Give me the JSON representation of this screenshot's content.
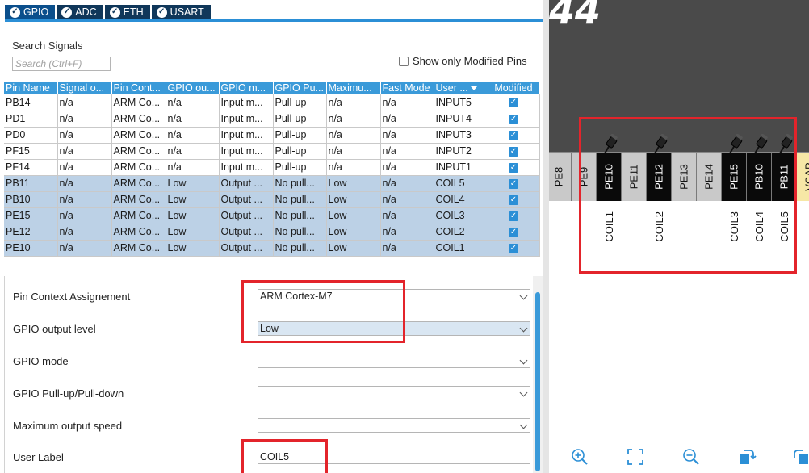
{
  "tabs": [
    {
      "label": "GPIO",
      "active": true
    },
    {
      "label": "ADC",
      "active": false
    },
    {
      "label": "ETH",
      "active": false
    },
    {
      "label": "USART",
      "active": false
    }
  ],
  "search": {
    "label": "Search Signals",
    "placeholder": "Search (Ctrl+F)"
  },
  "only_modified_label": "Show only Modified Pins",
  "table": {
    "columns": [
      "Pin Name",
      "Signal o...",
      "Pin Cont...",
      "GPIO ou...",
      "GPIO m...",
      "GPIO Pu...",
      "Maximu...",
      "Fast Mode",
      "User ...",
      "Modified"
    ],
    "rows": [
      {
        "pin": "PB14",
        "signal": "n/a",
        "context": "ARM Co...",
        "out": "n/a",
        "mode": "Input m...",
        "pull": "Pull-up",
        "max": "n/a",
        "fast": "n/a",
        "label": "INPUT5",
        "modified": true,
        "selected": false
      },
      {
        "pin": "PD1",
        "signal": "n/a",
        "context": "ARM Co...",
        "out": "n/a",
        "mode": "Input m...",
        "pull": "Pull-up",
        "max": "n/a",
        "fast": "n/a",
        "label": "INPUT4",
        "modified": true,
        "selected": false
      },
      {
        "pin": "PD0",
        "signal": "n/a",
        "context": "ARM Co...",
        "out": "n/a",
        "mode": "Input m...",
        "pull": "Pull-up",
        "max": "n/a",
        "fast": "n/a",
        "label": "INPUT3",
        "modified": true,
        "selected": false
      },
      {
        "pin": "PF15",
        "signal": "n/a",
        "context": "ARM Co...",
        "out": "n/a",
        "mode": "Input m...",
        "pull": "Pull-up",
        "max": "n/a",
        "fast": "n/a",
        "label": "INPUT2",
        "modified": true,
        "selected": false
      },
      {
        "pin": "PF14",
        "signal": "n/a",
        "context": "ARM Co...",
        "out": "n/a",
        "mode": "Input m...",
        "pull": "Pull-up",
        "max": "n/a",
        "fast": "n/a",
        "label": "INPUT1",
        "modified": true,
        "selected": false
      },
      {
        "pin": "PB11",
        "signal": "n/a",
        "context": "ARM Co...",
        "out": "Low",
        "mode": "Output ...",
        "pull": "No pull...",
        "max": "Low",
        "fast": "n/a",
        "label": "COIL5",
        "modified": true,
        "selected": true
      },
      {
        "pin": "PB10",
        "signal": "n/a",
        "context": "ARM Co...",
        "out": "Low",
        "mode": "Output ...",
        "pull": "No pull...",
        "max": "Low",
        "fast": "n/a",
        "label": "COIL4",
        "modified": true,
        "selected": true
      },
      {
        "pin": "PE15",
        "signal": "n/a",
        "context": "ARM Co...",
        "out": "Low",
        "mode": "Output ...",
        "pull": "No pull...",
        "max": "Low",
        "fast": "n/a",
        "label": "COIL3",
        "modified": true,
        "selected": true
      },
      {
        "pin": "PE12",
        "signal": "n/a",
        "context": "ARM Co...",
        "out": "Low",
        "mode": "Output ...",
        "pull": "No pull...",
        "max": "Low",
        "fast": "n/a",
        "label": "COIL2",
        "modified": true,
        "selected": true
      },
      {
        "pin": "PE10",
        "signal": "n/a",
        "context": "ARM Co...",
        "out": "Low",
        "mode": "Output ...",
        "pull": "No pull...",
        "max": "Low",
        "fast": "n/a",
        "label": "COIL1",
        "modified": true,
        "selected": true
      }
    ]
  },
  "config": {
    "context_label": "Pin Context Assignement",
    "context_value": "ARM Cortex-M7",
    "output_level_label": "GPIO output level",
    "output_level_value": "Low",
    "mode_label": "GPIO mode",
    "mode_value": "",
    "pull_label": "GPIO Pull-up/Pull-down",
    "pull_value": "",
    "speed_label": "Maximum output speed",
    "speed_value": "",
    "user_label_label": "User Label",
    "user_label_value": "COIL5"
  },
  "chip": {
    "mark": "44",
    "pins": [
      {
        "name": "PE8",
        "style": "gray",
        "pinned": false
      },
      {
        "name": "PE9",
        "style": "gray",
        "pinned": false
      },
      {
        "name": "PE10",
        "style": "black",
        "pinned": true
      },
      {
        "name": "PE11",
        "style": "gray",
        "pinned": false
      },
      {
        "name": "PE12",
        "style": "black",
        "pinned": true
      },
      {
        "name": "PE13",
        "style": "gray",
        "pinned": false
      },
      {
        "name": "PE14",
        "style": "gray",
        "pinned": false
      },
      {
        "name": "PE15",
        "style": "black",
        "pinned": true
      },
      {
        "name": "PB10",
        "style": "black",
        "pinned": true
      },
      {
        "name": "PB11",
        "style": "black",
        "pinned": true
      },
      {
        "name": "VCAP",
        "style": "yellow",
        "pinned": false
      }
    ],
    "coil_labels": [
      "COIL1",
      "COIL2",
      "COIL3",
      "COIL4",
      "COIL5"
    ]
  },
  "tools": [
    "zoom-in-icon",
    "fit-screen-icon",
    "zoom-out-icon",
    "rotate-icon",
    "undo-icon"
  ],
  "colors": {
    "tab_bg": "#10375a",
    "header_blue": "#3a9ad9",
    "selected_row": "#bcd1e6",
    "highlight_red": "#e3242b",
    "chip_gray": "#4a4a4a"
  }
}
